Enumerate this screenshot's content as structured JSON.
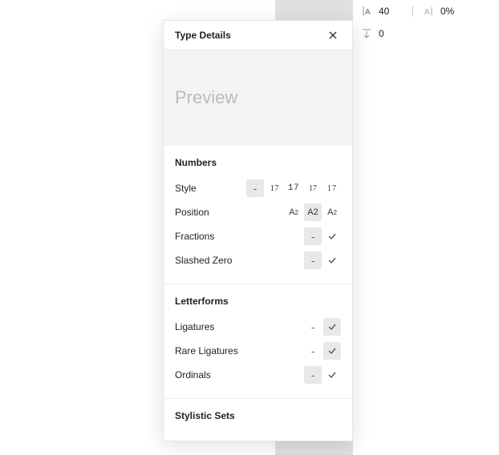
{
  "sidebar": {
    "line_height": "40",
    "letter_spacing": "0%",
    "paragraph_spacing": "0"
  },
  "panel": {
    "title": "Type Details",
    "preview": "Preview"
  },
  "numbers": {
    "title": "Numbers",
    "style": {
      "label": "Style",
      "options": [
        "-",
        "17",
        "17",
        "17",
        "17"
      ]
    },
    "position": {
      "label": "Position",
      "options": [
        "A₂",
        "A2",
        "A²"
      ]
    },
    "fractions": {
      "label": "Fractions"
    },
    "slashed_zero": {
      "label": "Slashed Zero"
    }
  },
  "letterforms": {
    "title": "Letterforms",
    "ligatures": {
      "label": "Ligatures"
    },
    "rare_ligatures": {
      "label": "Rare Ligatures"
    },
    "ordinals": {
      "label": "Ordinals"
    }
  },
  "stylistic_sets": {
    "title": "Stylistic Sets"
  }
}
